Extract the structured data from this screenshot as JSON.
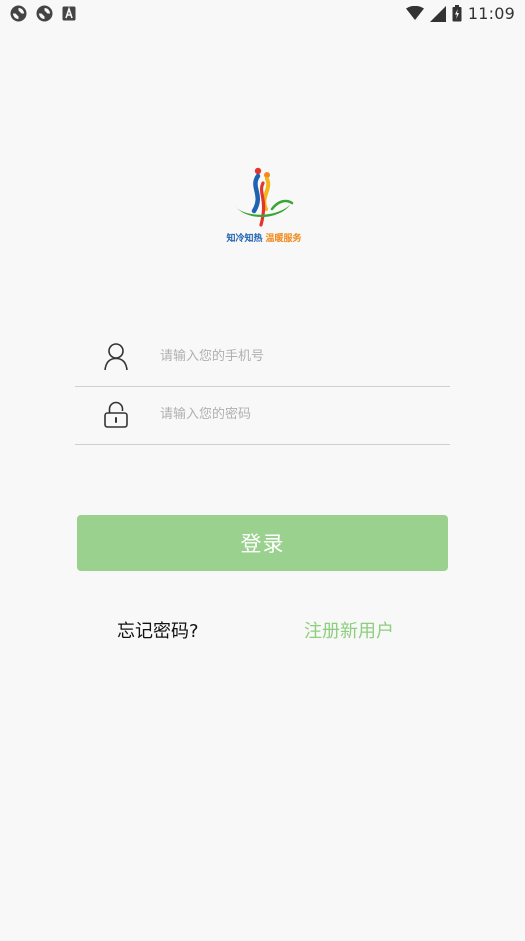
{
  "status_bar": {
    "time": "11:09",
    "left_icons": [
      "sync-icon",
      "sync-icon",
      "font-a-icon"
    ],
    "right_icons": [
      "wifi-icon",
      "signal-icon",
      "battery-icon"
    ]
  },
  "logo": {
    "text_part1": "知冷知热",
    "text_part2": "温暖服务",
    "colors": {
      "blue": "#1e62b0",
      "orange": "#f08a1c",
      "green": "#3aa635",
      "red": "#e2362c"
    }
  },
  "form": {
    "phone": {
      "placeholder": "请输入您的手机号",
      "value": "",
      "icon": "user-icon"
    },
    "password": {
      "placeholder": "请输入您的密码",
      "value": "",
      "icon": "lock-icon"
    }
  },
  "actions": {
    "login_label": "登录",
    "forgot_label": "忘记密码?",
    "register_label": "注册新用户"
  },
  "colors": {
    "primary": "#9bd18e",
    "link_green": "#8ccf7d",
    "background": "#f8f8f8"
  }
}
